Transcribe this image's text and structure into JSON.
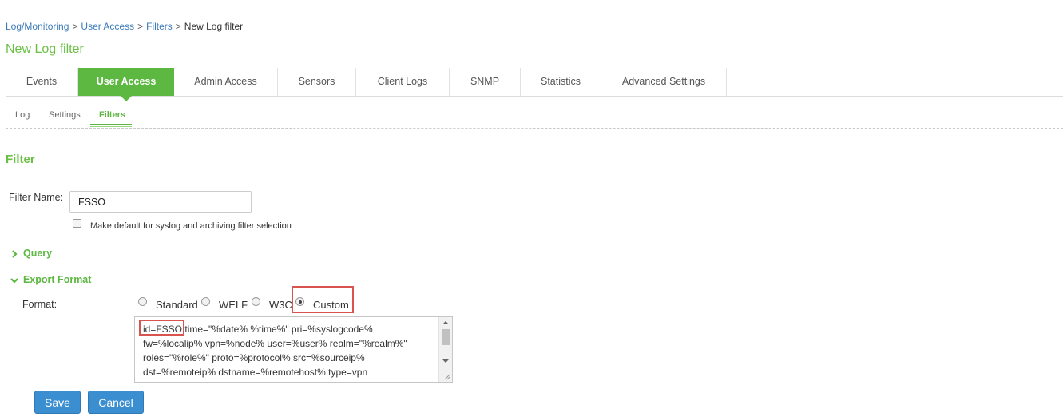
{
  "breadcrumb": {
    "items": [
      {
        "label": "Log/Monitoring"
      },
      {
        "label": "User Access"
      },
      {
        "label": "Filters"
      }
    ],
    "current": "New Log filter",
    "separator": ">"
  },
  "page_title": "New Log filter",
  "tabs": [
    {
      "label": "Events"
    },
    {
      "label": "User Access"
    },
    {
      "label": "Admin Access"
    },
    {
      "label": "Sensors"
    },
    {
      "label": "Client Logs"
    },
    {
      "label": "SNMP"
    },
    {
      "label": "Statistics"
    },
    {
      "label": "Advanced Settings"
    }
  ],
  "active_tab": "User Access",
  "subtabs": [
    {
      "label": "Log"
    },
    {
      "label": "Settings"
    },
    {
      "label": "Filters"
    }
  ],
  "active_subtab": "Filters",
  "section_title": "Filter",
  "filter_name": {
    "label": "Filter Name:",
    "value": "FSSO"
  },
  "default_checkbox": {
    "label": "Make default for syslog and archiving filter selection",
    "checked": false
  },
  "query_section": {
    "label": "Query",
    "expanded": false
  },
  "export_section": {
    "label": "Export Format",
    "expanded": true
  },
  "format": {
    "label": "Format:",
    "options": [
      {
        "label": "Standard",
        "selected": false
      },
      {
        "label": "WELF",
        "selected": false
      },
      {
        "label": "W3C",
        "selected": false
      },
      {
        "label": "Custom",
        "selected": true
      }
    ]
  },
  "custom_format": {
    "highlighted_prefix": "id=FSSO",
    "text": " time=\"%date% %time%\" pri=%syslogcode%\nfw=%localip% vpn=%node% user=%user% realm=\"%realm%\"\nroles=\"%role%\" proto=%protocol% src=%sourceip%\ndst=%remoteip% dstname=%remotehost% type=vpn\nop=%method% arg=\"%uri%\" result=%status% sent=%bytes%"
  },
  "buttons": {
    "save": "Save",
    "cancel": "Cancel"
  },
  "colors": {
    "accent_green": "#5cb841",
    "link_blue": "#3a7ab8",
    "button_blue": "#3b8ed0",
    "highlight_red": "#d9534f"
  },
  "icons": {
    "query": "chevron-right-icon",
    "export": "chevron-down-icon"
  }
}
